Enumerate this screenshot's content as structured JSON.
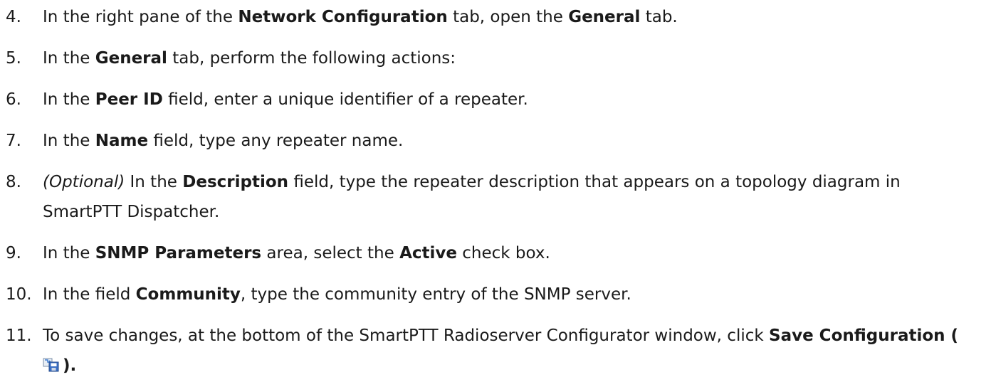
{
  "steps": [
    {
      "number": "4.",
      "t1": "In the right pane of the ",
      "b1": "Network Configuration",
      "t2": " tab, open the ",
      "b2": "General",
      "t3": " tab."
    },
    {
      "number": "5.",
      "t1": "In the ",
      "b1": "General",
      "t2": " tab, perform the following actions:"
    },
    {
      "number": "6.",
      "t1": "In the ",
      "b1": "Peer ID",
      "t2": " field, enter a unique identifier of a repeater."
    },
    {
      "number": "7.",
      "t1": "In the ",
      "b1": "Name",
      "t2": " field, type any repeater name."
    },
    {
      "number": "8.",
      "i1": "(Optional)",
      "t1": " In the ",
      "b1": "Description",
      "t2": " field, type the repeater description that appears on a topology diagram in",
      "line2": "SmartPTT Dispatcher."
    },
    {
      "number": "9.",
      "t1": "In the ",
      "b1": "SNMP Parameters",
      "t2": " area, select the ",
      "b2": "Active",
      "t3": " check box."
    },
    {
      "number": "10.",
      "t1": "In the field ",
      "b1": "Community",
      "t2": ", type the community entry of the SNMP server."
    },
    {
      "number": "11.",
      "t1": "To save changes, at the bottom of the SmartPTT Radioserver Configurator window, click ",
      "b1": "Save Configuration (",
      "icon": "save-configuration-icon",
      "b2": ")."
    }
  ]
}
